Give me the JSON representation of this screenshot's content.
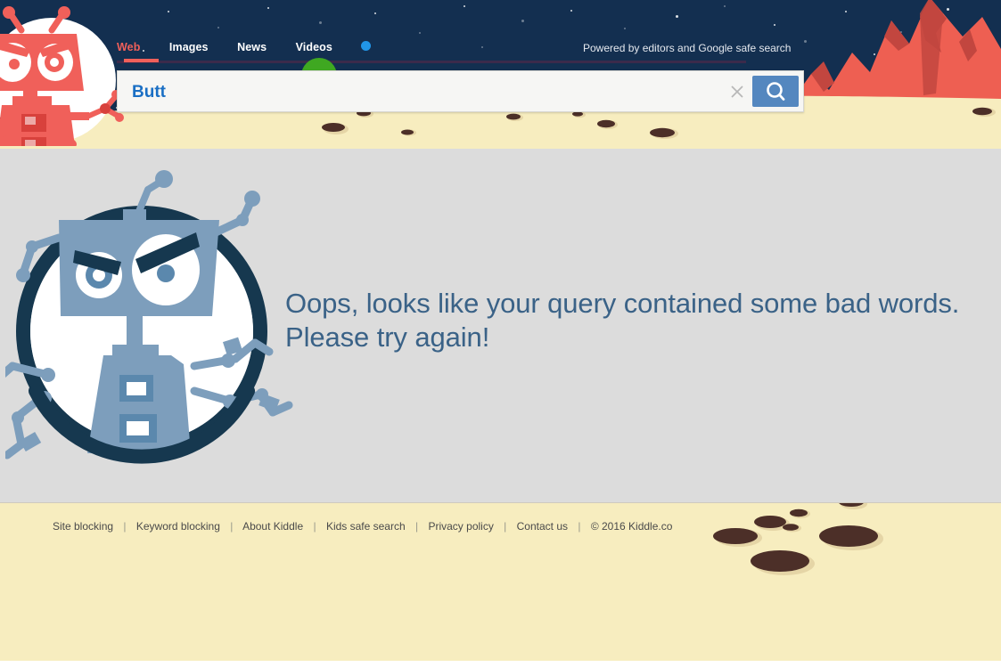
{
  "header": {
    "nav": {
      "tabs": [
        {
          "label": "Web",
          "active": true
        },
        {
          "label": "Images",
          "active": false
        },
        {
          "label": "News",
          "active": false
        },
        {
          "label": "Videos",
          "active": false
        }
      ],
      "dot_icon": "blue-dot-icon"
    },
    "powered_by": "Powered by editors and Google safe search",
    "robot_icon": "red-robot-mascot-icon",
    "scene": {
      "sky_color": "#132f50",
      "mountain_color": "#ee5f52",
      "mountain_shadow_color": "#b8413c",
      "ground_color": "#f7edbf",
      "star_icon": "star-icon",
      "green_hill_color": "#3fa821"
    }
  },
  "search": {
    "value": "Butt",
    "placeholder": "",
    "clear_icon": "close-x-icon",
    "search_icon": "magnifier-icon",
    "button_color": "#5487bf",
    "text_color": "#1a6fc4"
  },
  "main": {
    "message_line1": "Oops, looks like your query contained some bad words.",
    "message_line2": "Please try again!",
    "message_color": "#3a6287",
    "background_color": "#dcdcdc",
    "robot_icon": "angry-blue-robot-icon"
  },
  "footer": {
    "background_color": "#f7edbf",
    "links": [
      {
        "label": "Site blocking"
      },
      {
        "label": "Keyword blocking"
      },
      {
        "label": "About Kiddle"
      },
      {
        "label": "Kids safe search"
      },
      {
        "label": "Privacy policy"
      },
      {
        "label": "Contact us"
      }
    ],
    "separator": "|",
    "copyright": "© 2016 Kiddle.co",
    "crater_icon": "crater-icon"
  }
}
